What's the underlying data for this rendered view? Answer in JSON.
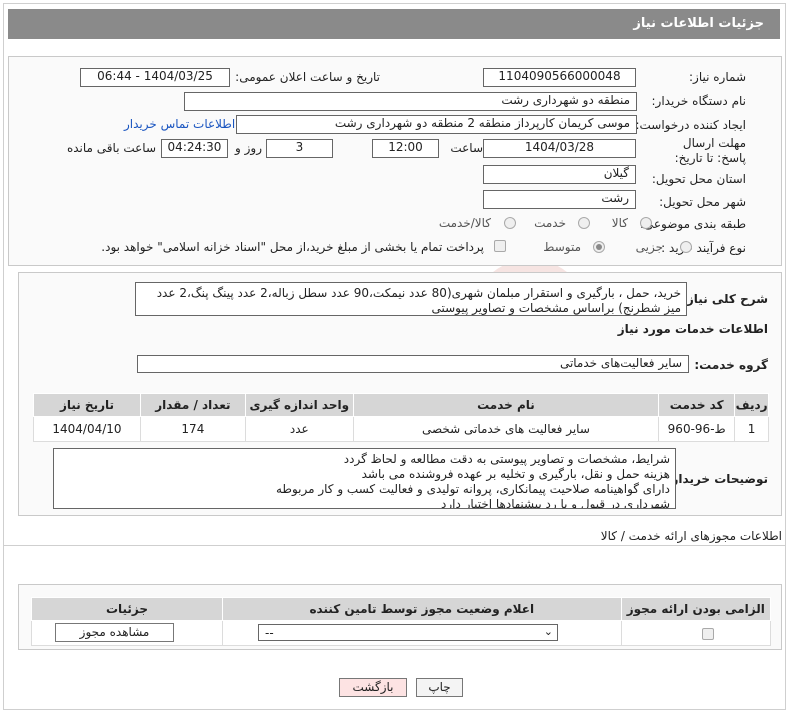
{
  "header": {
    "title": "جزئیات اطلاعات نیاز"
  },
  "fields": {
    "need_number_label": "شماره نیاز:",
    "need_number": "1104090566000048",
    "announce_label": "تاریخ و ساعت اعلان عمومی:",
    "announce_value": "1404/03/25 - 06:44",
    "buyer_org_label": "نام دستگاه خریدار:",
    "buyer_org": "منطقه دو شهرداری رشت",
    "creator_label": "ایجاد کننده درخواست:",
    "creator": "موسی کریمان کارپرداز منطقه 2 منطقه دو شهرداری رشت",
    "contact_link": "اطلاعات تماس خریدار",
    "deadline_label": "مهلت ارسال پاسخ: تا تاریخ:",
    "deadline_date": "1404/03/28",
    "time_label": "ساعت",
    "deadline_time": "12:00",
    "days_value": "3",
    "days_label": "روز و",
    "remaining_time": "04:24:30",
    "remaining_label": "ساعت باقی مانده",
    "province_label": "استان محل تحویل:",
    "province": "گیلان",
    "city_label": "شهر محل تحویل:",
    "city": "رشت",
    "category_label": "طبقه بندی موضوعی:",
    "category_options": [
      "کالا",
      "خدمت",
      "کالا/خدمت"
    ],
    "process_label": "نوع فرآیند خرید :",
    "process_options": [
      "جزیی",
      "متوسط"
    ],
    "payment_note": "پرداخت تمام یا بخشی از مبلغ خرید،از محل \"اسناد خزانه اسلامی\" خواهد بود."
  },
  "summary": {
    "label": "شرح کلی نیاز:",
    "text": "خرید، حمل ، بارگیری و استقرار مبلمان شهری(80 عدد نیمکت،90 عدد سطل زباله،2 عدد پینگ پنگ،2 عدد میز شطرنج) براساس مشخصات و تصاویر پیوستی"
  },
  "services": {
    "title": "اطلاعات خدمات مورد نیاز",
    "group_label": "گروه خدمت:",
    "group_value": "سایر فعالیت‌های خدماتی",
    "columns": [
      "ردیف",
      "کد خدمت",
      "نام خدمت",
      "واحد اندازه گیری",
      "تعداد / مقدار",
      "تاریخ نیاز"
    ],
    "rows": [
      [
        "1",
        "ط-96-960",
        "سایر فعالیت های خدماتی شخصی",
        "عدد",
        "174",
        "1404/04/10"
      ]
    ]
  },
  "buyer_notes": {
    "label": "توضیحات خریدار:",
    "text": "شرایط، مشخصات و تصاویر پیوستی به دقت مطالعه و لحاظ گردد\nهزینه حمل و نقل، بارگیری و تخلیه بر عهده فروشنده می باشد\nدارای گواهینامه صلاحیت پیمانکاری، پروانه تولیدی و فعالیت کسب و کار مربوطه\nشهرداری در قبول و یا رد پیشنهادها اختیار دارد"
  },
  "permits": {
    "title": "اطلاعات مجوزهای ارائه خدمت / کالا",
    "columns": [
      "الزامی بودن ارائه مجوز",
      "اعلام وضعیت مجوز توسط تامین کننده",
      "جزئیات"
    ],
    "select_value": "--",
    "view_button": "مشاهده مجوز"
  },
  "footer": {
    "print_button": "چاپ",
    "back_button": "بازگشت"
  },
  "colors": {
    "header_bg": "#8a8a8a",
    "link": "#1a55c0",
    "table_head": "#d6d6d6"
  }
}
